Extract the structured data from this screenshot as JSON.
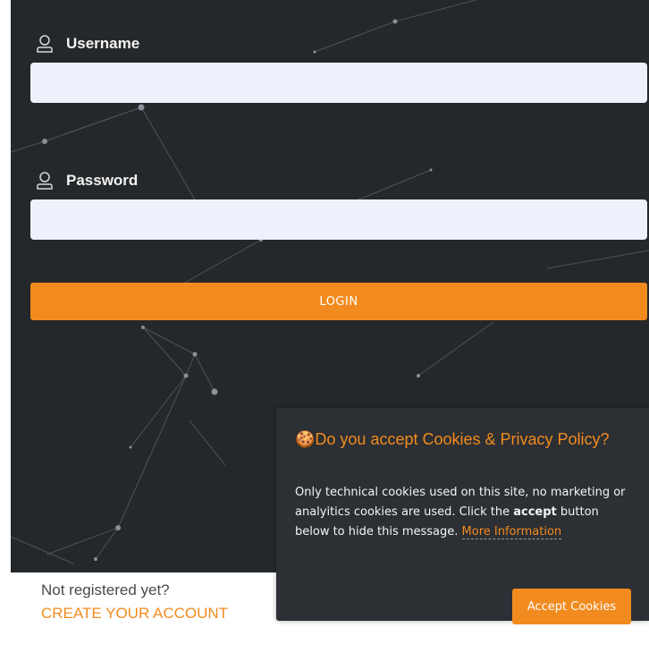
{
  "form": {
    "username_label": "Username",
    "username_value": "",
    "password_label": "Password",
    "password_value": "",
    "login_label": "LOGIN"
  },
  "register": {
    "prompt": "Not registered yet?",
    "link": "CREATE YOUR ACCOUNT"
  },
  "cookie_banner": {
    "title": "🍪Do you accept Cookies & Privacy Policy?",
    "text_before": "Only technical cookies used on this site, no marketing or analyitics cookies are used. Click the ",
    "bold_word": "accept",
    "text_after": " button below to hide this message. ",
    "more_link": "More Information",
    "accept_label": "Accept Cookies"
  },
  "colors": {
    "panel_background": "#25282b",
    "accent": "#f28b1f",
    "input_background": "#eef0fb",
    "banner_background": "#2c2f33"
  },
  "icons": {
    "username": "user-icon",
    "password": "user-icon",
    "cookie": "cookie-icon"
  }
}
